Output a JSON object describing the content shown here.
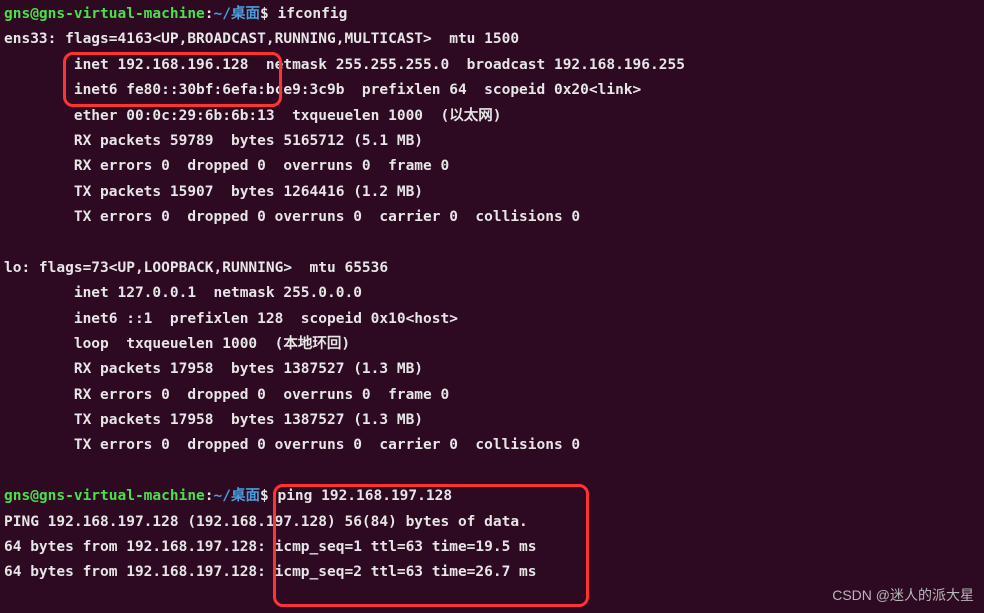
{
  "prompt1": {
    "user": "gns@gns-virtual-machine",
    "sep": ":",
    "path": "~/桌面",
    "dollar": "$ ",
    "cmd": "ifconfig"
  },
  "ifconfig": {
    "ens33": {
      "l1": "ens33: flags=4163<UP,BROADCAST,RUNNING,MULTICAST>  mtu 1500",
      "l2": "        inet 192.168.196.128  netmask 255.255.255.0  broadcast 192.168.196.255",
      "l3": "        inet6 fe80::30bf:6efa:bce9:3c9b  prefixlen 64  scopeid 0x20<link>",
      "l4": "        ether 00:0c:29:6b:6b:13  txqueuelen 1000  (以太网)",
      "l5": "        RX packets 59789  bytes 5165712 (5.1 MB)",
      "l6": "        RX errors 0  dropped 0  overruns 0  frame 0",
      "l7": "        TX packets 15907  bytes 1264416 (1.2 MB)",
      "l8": "        TX errors 0  dropped 0 overruns 0  carrier 0  collisions 0"
    },
    "lo": {
      "l1": "lo: flags=73<UP,LOOPBACK,RUNNING>  mtu 65536",
      "l2": "        inet 127.0.0.1  netmask 255.0.0.0",
      "l3": "        inet6 ::1  prefixlen 128  scopeid 0x10<host>",
      "l4": "        loop  txqueuelen 1000  (本地环回)",
      "l5": "        RX packets 17958  bytes 1387527 (1.3 MB)",
      "l6": "        RX errors 0  dropped 0  overruns 0  frame 0",
      "l7": "        TX packets 17958  bytes 1387527 (1.3 MB)",
      "l8": "        TX errors 0  dropped 0 overruns 0  carrier 0  collisions 0"
    }
  },
  "prompt2": {
    "user": "gns@gns-virtual-machine",
    "sep": ":",
    "path": "~/桌面",
    "dollar": "$ ",
    "cmd": "ping 192.168.197.128"
  },
  "ping": {
    "l1": "PING 192.168.197.128 (192.168.197.128) 56(84) bytes of data.",
    "l2": "64 bytes from 192.168.197.128: icmp_seq=1 ttl=63 time=19.5 ms",
    "l3": "64 bytes from 192.168.197.128: icmp_seq=2 ttl=63 time=26.7 ms"
  },
  "watermark": "CSDN @迷人的派大星"
}
